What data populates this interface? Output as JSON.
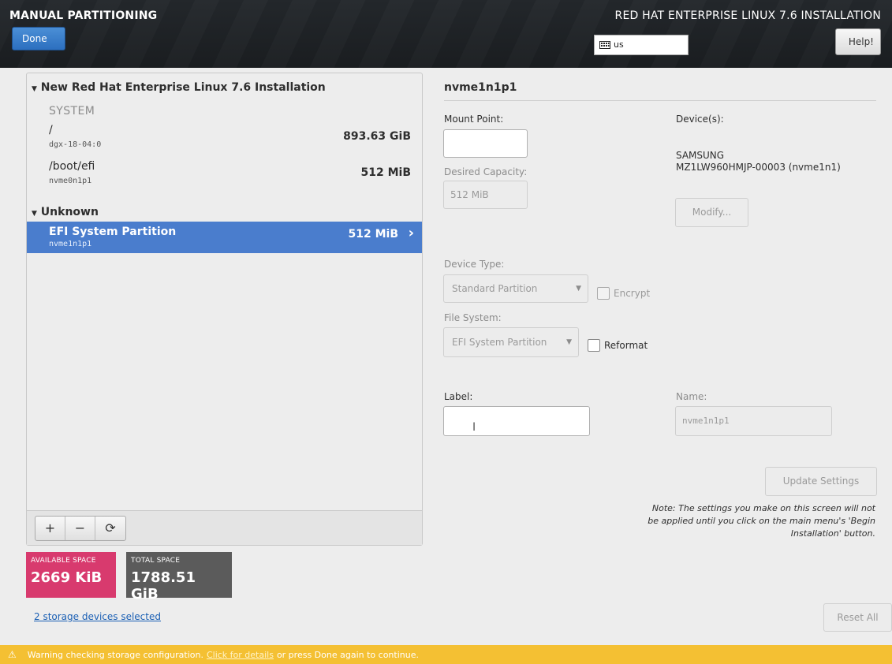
{
  "header": {
    "spoke_title": "MANUAL PARTITIONING",
    "done_label": "Done",
    "product_title": "RED HAT ENTERPRISE LINUX 7.6 INSTALLATION",
    "keyboard_layout": "us",
    "help_label": "Help!"
  },
  "left": {
    "group1": {
      "name": "New Red Hat Enterprise Linux 7.6 Installation",
      "section": "SYSTEM",
      "items": [
        {
          "mount": "/",
          "device": "dgx-18-04:0",
          "size": "893.63 GiB"
        },
        {
          "mount": "/boot/efi",
          "device": "nvme0n1p1",
          "size": "512 MiB"
        }
      ]
    },
    "group2": {
      "name": "Unknown",
      "items": [
        {
          "mount": "EFI System Partition",
          "device": "nvme1n1p1",
          "size": "512 MiB"
        }
      ]
    },
    "toolbar": {
      "add": "+",
      "remove": "−",
      "refresh": "⟳"
    }
  },
  "space": {
    "available_label": "AVAILABLE SPACE",
    "available_value": "2669 KiB",
    "total_label": "TOTAL SPACE",
    "total_value": "1788.51 GiB"
  },
  "storage_link": "2 storage devices selected",
  "right": {
    "partition_name": "nvme1n1p1",
    "mount_point_label": "Mount Point:",
    "mount_point_value": "",
    "desired_capacity_label": "Desired Capacity:",
    "desired_capacity_value": "512 MiB",
    "devices_label": "Device(s):",
    "device_line1": "SAMSUNG",
    "device_line2": "MZ1LW960HMJP-00003 (nvme1n1)",
    "modify_label": "Modify...",
    "device_type_label": "Device Type:",
    "device_type_value": "Standard Partition",
    "encrypt_label": "Encrypt",
    "file_system_label": "File System:",
    "file_system_value": "EFI System Partition",
    "reformat_label": "Reformat",
    "label_label": "Label:",
    "label_value": "",
    "name_label": "Name:",
    "name_value": "nvme1n1p1",
    "update_label": "Update Settings",
    "note_line1": "Note:  The settings you make on this screen will not",
    "note_line2": "be applied until you click on the main menu's 'Begin",
    "note_line3": "Installation' button."
  },
  "reset_label": "Reset All",
  "warning": {
    "text_before": "Warning checking storage configuration.",
    "link": "Click for details",
    "text_after": "or press Done again to continue."
  },
  "colors": {
    "accent_blue": "#4a7dcd",
    "available_space": "#d83a6e",
    "total_space": "#5b5b5b",
    "warning_bar": "#f4c033"
  }
}
